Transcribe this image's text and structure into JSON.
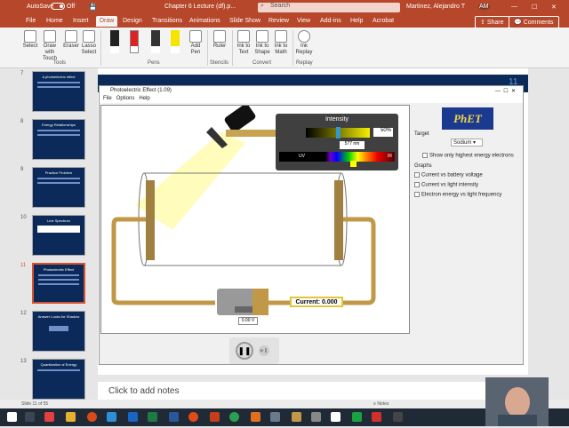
{
  "titlebar": {
    "autosave": "AutoSave",
    "autosave_state": "Off",
    "doc_title": "Chapter 6 Lecture (df).p...",
    "search_placeholder": "Search",
    "user": "Martinez, Alejandro T",
    "user_initials": "AM"
  },
  "menu_tabs": [
    "File",
    "Home",
    "Insert",
    "Draw",
    "Design",
    "Transitions",
    "Animations",
    "Slide Show",
    "Review",
    "View",
    "Add-ins",
    "Help",
    "Acrobat"
  ],
  "active_tab": "Draw",
  "share_label": "Share",
  "comments_label": "Comments",
  "ribbon": {
    "tools": [
      {
        "label": "Select"
      },
      {
        "label": "Draw with Touch"
      },
      {
        "label": "Eraser"
      },
      {
        "label": "Lasso Select"
      }
    ],
    "tools_group": "Tools",
    "pens_group": "Pens",
    "add_pen": "Add Pen",
    "ruler": "Ruler",
    "stencils_group": "Stencils",
    "convert": [
      {
        "label": "Ink to Text"
      },
      {
        "label": "Ink to Shape"
      },
      {
        "label": "Ink to Math"
      }
    ],
    "convert_group": "Convert",
    "ink_replay": "Ink Replay",
    "replay_group": "Replay"
  },
  "thumbnails": [
    {
      "num": "7",
      "title": "A photoelectric effect"
    },
    {
      "num": "8",
      "title": "Energy Relationships"
    },
    {
      "num": "9",
      "title": "Practice Problem"
    },
    {
      "num": "10",
      "title": "Line Spectrum"
    },
    {
      "num": "11",
      "title": "Photoelectric Effect"
    },
    {
      "num": "12",
      "title": "Answer Looks for Shadow"
    },
    {
      "num": "13",
      "title": "Quantization of Energy"
    }
  ],
  "selected_slide": "11",
  "slide_number_label": "11",
  "phet": {
    "window_title": "Photoelectric Effect (1.09)",
    "menu": [
      "File",
      "Options",
      "Help"
    ],
    "intensity_title": "Intensity",
    "intensity_value": "50%",
    "intensity_level": 0.5,
    "wavelength": "577 nm",
    "spectrum_uv": "UV",
    "spectrum_ir": "IR",
    "current_label": "Current:",
    "current_value": "0.000",
    "voltage": "0.00 V",
    "logo": "PhET",
    "target_label": "Target",
    "target_value": "Sodium",
    "show_highest": "Show only highest energy electrons",
    "graphs_label": "Graphs",
    "graphs": [
      "Current vs battery voltage",
      "Current vs light intensity",
      "Electron energy vs light frequency"
    ]
  },
  "notes_placeholder": "Click to add notes",
  "status": {
    "slide_info": "Slide 11 of 55",
    "notes": "Notes"
  }
}
